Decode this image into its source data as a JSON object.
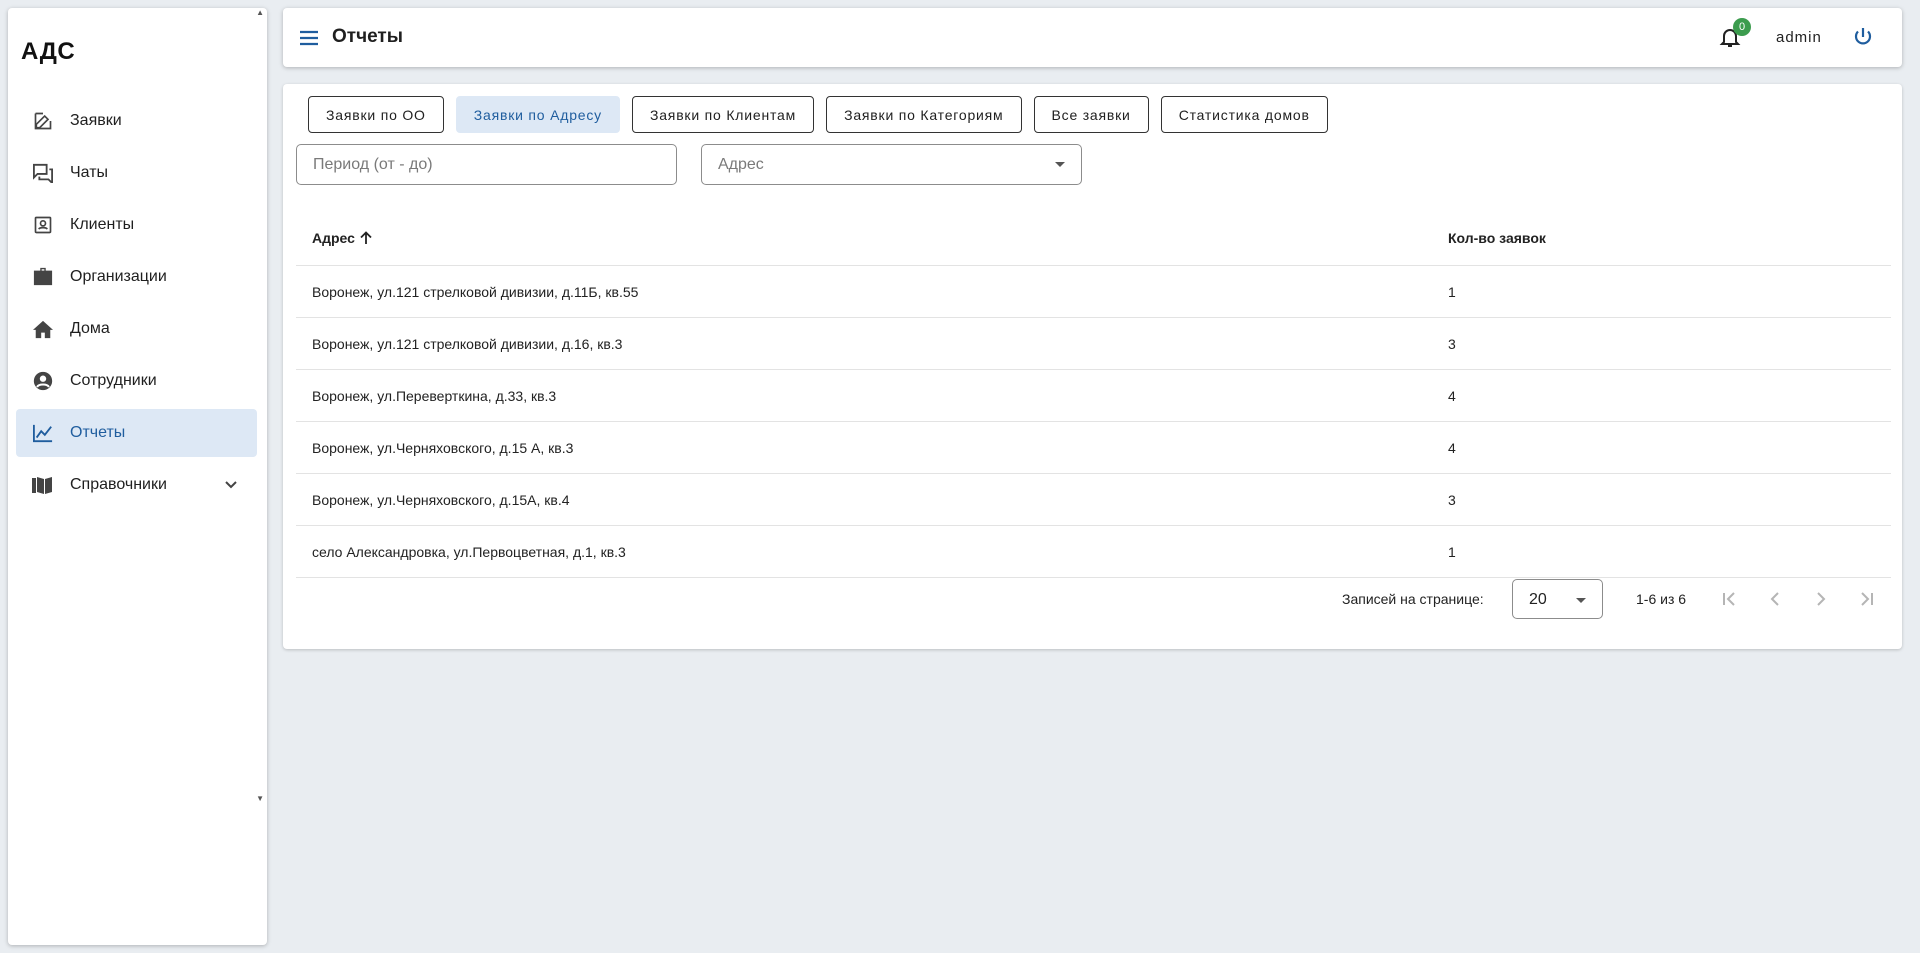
{
  "app": {
    "brand": "АДС"
  },
  "sidebar": {
    "items": [
      {
        "label": "Заявки",
        "icon": "edit-icon"
      },
      {
        "label": "Чаты",
        "icon": "chat-icon"
      },
      {
        "label": "Клиенты",
        "icon": "contact-card-icon"
      },
      {
        "label": "Организации",
        "icon": "briefcase-icon"
      },
      {
        "label": "Дома",
        "icon": "home-icon"
      },
      {
        "label": "Сотрудники",
        "icon": "account-circle-icon"
      },
      {
        "label": "Отчеты",
        "icon": "chart-line-icon",
        "active": true
      },
      {
        "label": "Справочники",
        "icon": "book-icon",
        "expandable": true
      }
    ]
  },
  "header": {
    "title": "Отчеты",
    "notifications_count": "0",
    "user": "admin"
  },
  "tabs": [
    {
      "label": "Заявки по ОО"
    },
    {
      "label": "Заявки по Адресу",
      "active": true
    },
    {
      "label": "Заявки по Клиентам"
    },
    {
      "label": "Заявки по Категориям"
    },
    {
      "label": "Все заявки"
    },
    {
      "label": "Статистика домов"
    }
  ],
  "filters": {
    "period_placeholder": "Период (от - до)",
    "address_placeholder": "Адрес"
  },
  "table": {
    "columns": {
      "address": "Адрес",
      "count": "Кол-во заявок"
    },
    "rows": [
      {
        "address": "Воронеж, ул.121 стрелковой дивизии, д.11Б, кв.55",
        "count": "1"
      },
      {
        "address": "Воронеж, ул.121 стрелковой дивизии, д.16, кв.3",
        "count": "3"
      },
      {
        "address": "Воронеж, ул.Переверткина, д.33, кв.3",
        "count": "4"
      },
      {
        "address": "Воронеж, ул.Черняховского, д.15 А, кв.3",
        "count": "4"
      },
      {
        "address": "Воронеж, ул.Черняховского, д.15А, кв.4",
        "count": "3"
      },
      {
        "address": "село Александровка, ул.Первоцветная, д.1, кв.3",
        "count": "1"
      }
    ]
  },
  "pagination": {
    "per_page_label": "Записей на странице:",
    "per_page_value": "20",
    "range": "1-6 из 6"
  },
  "colors": {
    "accent": "#1f5d9e",
    "active_bg": "#dde8f5",
    "badge": "#3c9c4e",
    "page_bg": "#e9edf1"
  }
}
